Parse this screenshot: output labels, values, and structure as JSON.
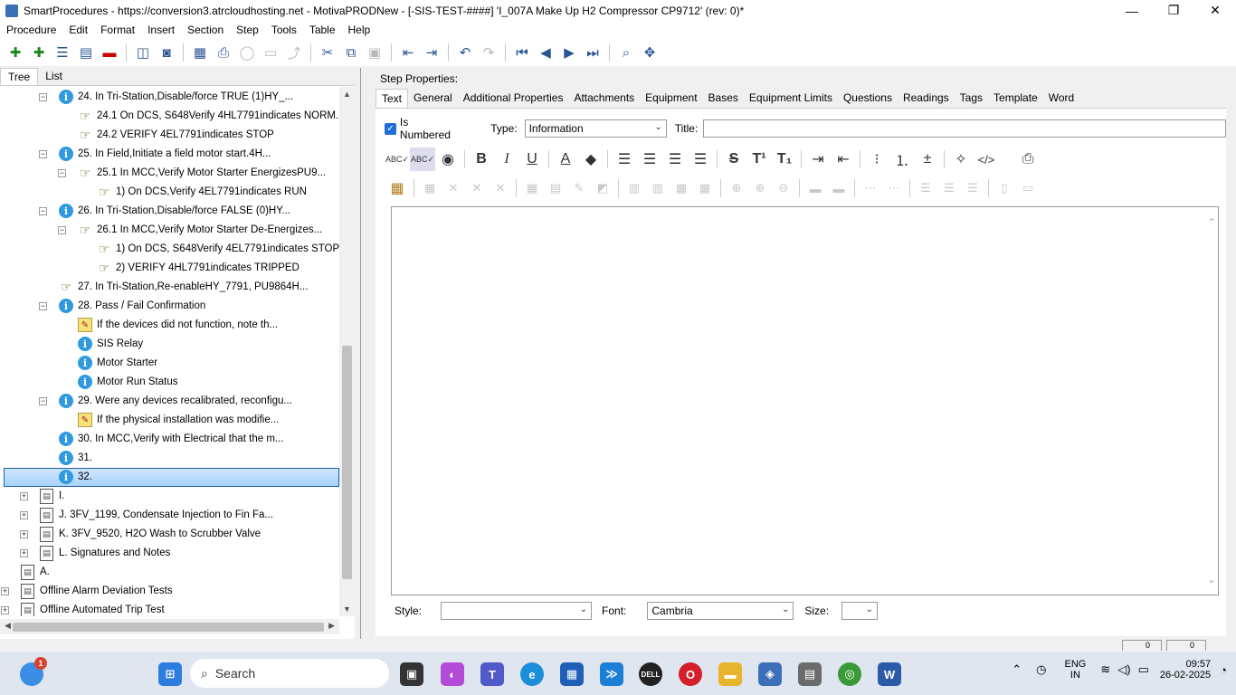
{
  "window": {
    "title": "SmartProcedures - https://conversion3.atrcloudhosting.net - MotivaPRODNew - [-SIS-TEST-####] 'I_007A Make Up H2 Compressor CP9712' (rev: 0)*",
    "minimize": "—",
    "maximize": "❐",
    "close": "✕"
  },
  "menu": [
    "Procedure",
    "Edit",
    "Format",
    "Insert",
    "Section",
    "Step",
    "Tools",
    "Table",
    "Help"
  ],
  "left_tabs": [
    "Tree",
    "List"
  ],
  "tree": [
    {
      "indent": 1,
      "exp": "−",
      "icon": "info",
      "label": "24. In Tri-Station,Disable/force TRUE (1)HY_..."
    },
    {
      "indent": 2,
      "exp": "",
      "icon": "hand",
      "label": "24.1 On DCS, S648Verify 4HL7791indicates NORM..."
    },
    {
      "indent": 2,
      "exp": "",
      "icon": "hand",
      "label": "24.2 VERIFY 4EL7791indicates STOP"
    },
    {
      "indent": 1,
      "exp": "−",
      "icon": "info",
      "label": "25. In Field,Initiate a field motor start.4H..."
    },
    {
      "indent": 2,
      "exp": "−",
      "icon": "hand",
      "label": "25.1 In MCC,Verify Motor Starter EnergizesPU9..."
    },
    {
      "indent": 3,
      "exp": "",
      "icon": "hand",
      "label": "1) On DCS,Verify 4EL7791indicates RUN"
    },
    {
      "indent": 1,
      "exp": "−",
      "icon": "info",
      "label": "26. In Tri-Station,Disable/force FALSE (0)HY..."
    },
    {
      "indent": 2,
      "exp": "−",
      "icon": "hand",
      "label": "26.1 In MCC,Verify Motor Starter De-Energizes..."
    },
    {
      "indent": 3,
      "exp": "",
      "icon": "hand",
      "label": "1) On DCS, S648Verify 4EL7791indicates STOP"
    },
    {
      "indent": 3,
      "exp": "",
      "icon": "hand",
      "label": "2) VERIFY 4HL7791indicates TRIPPED"
    },
    {
      "indent": 1,
      "exp": "",
      "icon": "hand",
      "label": "27. In Tri-Station,Re-enableHY_7791, PU9864H..."
    },
    {
      "indent": 1,
      "exp": "−",
      "icon": "info",
      "label": "28. Pass / Fail Confirmation"
    },
    {
      "indent": 2,
      "exp": "",
      "icon": "note",
      "label": "If the devices did not function, note th..."
    },
    {
      "indent": 2,
      "exp": "",
      "icon": "info",
      "label": "SIS Relay"
    },
    {
      "indent": 2,
      "exp": "",
      "icon": "info",
      "label": "Motor Starter"
    },
    {
      "indent": 2,
      "exp": "",
      "icon": "info",
      "label": "Motor Run Status"
    },
    {
      "indent": 1,
      "exp": "−",
      "icon": "info",
      "label": "29. Were any devices recalibrated, reconfigu..."
    },
    {
      "indent": 2,
      "exp": "",
      "icon": "note",
      "label": "If the physical installation was modifie..."
    },
    {
      "indent": 1,
      "exp": "",
      "icon": "info",
      "label": "30. In MCC,Verify with Electrical that the m..."
    },
    {
      "indent": 1,
      "exp": "",
      "icon": "info",
      "label": "31."
    },
    {
      "indent": 1,
      "exp": "",
      "icon": "info",
      "label": "32.",
      "selected": true
    },
    {
      "indent": 0,
      "exp": "+",
      "icon": "doc",
      "label": "I."
    },
    {
      "indent": 0,
      "exp": "+",
      "icon": "doc",
      "label": "J. 3FV_1199, Condensate Injection to Fin Fa..."
    },
    {
      "indent": 0,
      "exp": "+",
      "icon": "doc",
      "label": "K. 3FV_9520, H2O Wash to Scrubber Valve"
    },
    {
      "indent": 0,
      "exp": "+",
      "icon": "doc",
      "label": "L. Signatures and Notes"
    },
    {
      "indent": -1,
      "exp": "",
      "icon": "doc",
      "label": "A."
    },
    {
      "indent": -1,
      "exp": "+",
      "icon": "doc",
      "label": "Offline Alarm Deviation Tests"
    },
    {
      "indent": -1,
      "exp": "+",
      "icon": "doc",
      "label": "Offline Automated Trip Test"
    }
  ],
  "right": {
    "heading": "Step Properties:",
    "tabs": [
      "Text",
      "General",
      "Additional Properties",
      "Attachments",
      "Equipment",
      "Bases",
      "Equipment Limits",
      "Questions",
      "Readings",
      "Tags",
      "Template",
      "Word"
    ],
    "is_numbered_label": "Is Numbered",
    "type_label": "Type:",
    "type_value": "Information",
    "title_label": "Title:",
    "title_value": "",
    "style_label": "Style:",
    "style_value": "",
    "font_label": "Font:",
    "font_value": "Cambria",
    "size_label": "Size:",
    "size_value": ""
  },
  "status": {
    "cell1": "0",
    "cell2": "0"
  },
  "taskbar": {
    "search_label": "Search",
    "notification_count": "1",
    "lang": "ENG",
    "region": "IN",
    "time": "09:57",
    "date": "26-02-2025"
  }
}
